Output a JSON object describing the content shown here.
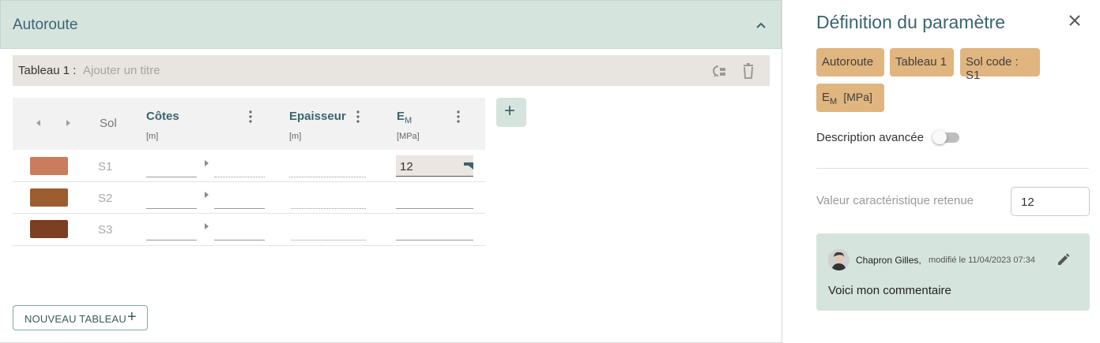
{
  "section": {
    "title": "Autoroute"
  },
  "tab": {
    "label": "Tableau 1 :",
    "placeholder": "Ajouter un titre"
  },
  "grid": {
    "columns": [
      {
        "name": "Sol",
        "unit": ""
      },
      {
        "name": "Côtes",
        "unit": "[m]"
      },
      {
        "name": "Epaisseur",
        "unit": "[m]"
      },
      {
        "name": "E",
        "sub": "M",
        "unit": "[MPa]"
      }
    ],
    "rows": [
      {
        "name": "S1",
        "color": "#c97d5c",
        "em_value": "12"
      },
      {
        "name": "S2",
        "color": "#9c5d2f",
        "em_value": ""
      },
      {
        "name": "S3",
        "color": "#7c3f22",
        "em_value": ""
      }
    ]
  },
  "buttons": {
    "new_table": "NOUVEAU TABLEAU"
  },
  "panel": {
    "title": "Définition du paramètre",
    "chips": [
      "Autoroute",
      "Tableau 1",
      "Sol code : S1"
    ],
    "param_chip": {
      "main": "E",
      "sub": "M",
      "unit": "[MPa]"
    },
    "advanced_label": "Description avancée",
    "advanced_on": false,
    "value_label": "Valeur caractéristique retenue",
    "value": "12",
    "comment": {
      "author": "Chapron Gilles,",
      "modified": "modifié le 11/04/2023 07:34",
      "text": "Voici mon commentaire"
    }
  },
  "colors": {
    "accent": "#3b6470",
    "header_bg": "#d6e4de",
    "chip_bg": "#e0b57f"
  },
  "icons": [
    "chevron-up-icon",
    "comment-icon",
    "trash-icon",
    "arrow-left-icon",
    "arrow-right-icon",
    "kebab-icon",
    "plus-icon",
    "close-icon",
    "edit-icon",
    "flag-icon"
  ]
}
